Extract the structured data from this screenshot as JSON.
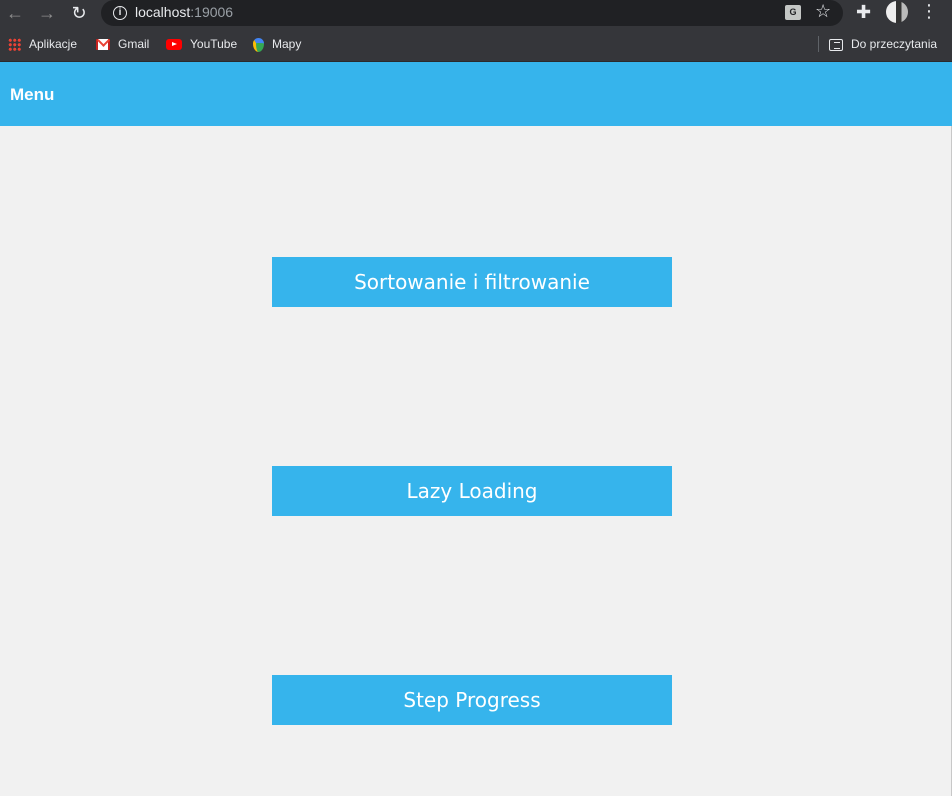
{
  "browser": {
    "url_host": "localhost",
    "url_port": ":19006",
    "bookmarks": [
      {
        "label": "Aplikacje",
        "icon": "apps-grid-icon"
      },
      {
        "label": "Gmail",
        "icon": "gmail-icon"
      },
      {
        "label": "YouTube",
        "icon": "youtube-icon"
      },
      {
        "label": "Mapy",
        "icon": "maps-icon"
      }
    ],
    "reading_list_label": "Do przeczytania"
  },
  "header": {
    "title": "Menu",
    "color": "#36b4ec"
  },
  "menu": {
    "buttons": [
      {
        "label": "Sortowanie i filtrowanie"
      },
      {
        "label": "Lazy Loading"
      },
      {
        "label": "Step Progress"
      }
    ],
    "button_color": "#36b4ec"
  },
  "colors": {
    "background": "#f1f1f1",
    "chrome": "#35363a",
    "omnibox": "#202124"
  }
}
